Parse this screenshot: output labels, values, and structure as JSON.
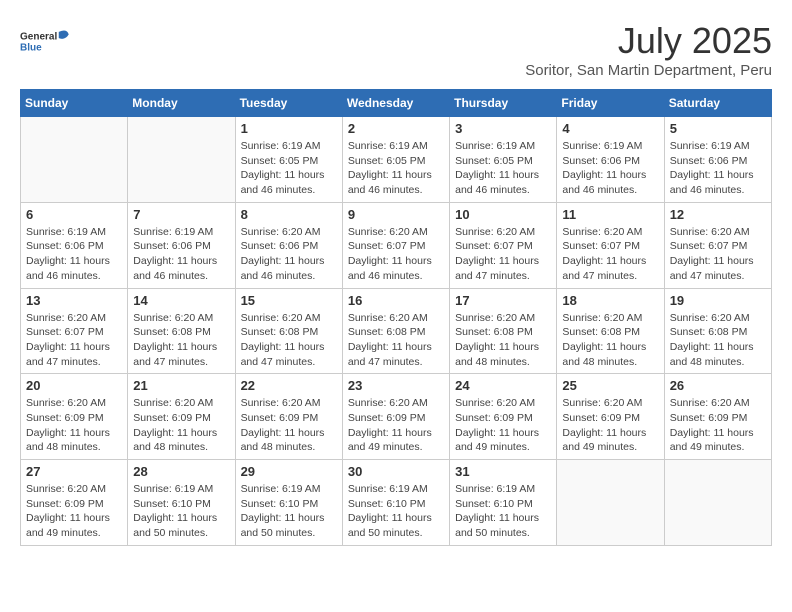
{
  "logo": {
    "general": "General",
    "blue": "Blue"
  },
  "title": {
    "month_year": "July 2025",
    "location": "Soritor, San Martin Department, Peru"
  },
  "weekdays": [
    "Sunday",
    "Monday",
    "Tuesday",
    "Wednesday",
    "Thursday",
    "Friday",
    "Saturday"
  ],
  "weeks": [
    [
      {
        "day": "",
        "info": ""
      },
      {
        "day": "",
        "info": ""
      },
      {
        "day": "1",
        "sunrise": "6:19 AM",
        "sunset": "6:05 PM",
        "daylight": "11 hours and 46 minutes."
      },
      {
        "day": "2",
        "sunrise": "6:19 AM",
        "sunset": "6:05 PM",
        "daylight": "11 hours and 46 minutes."
      },
      {
        "day": "3",
        "sunrise": "6:19 AM",
        "sunset": "6:05 PM",
        "daylight": "11 hours and 46 minutes."
      },
      {
        "day": "4",
        "sunrise": "6:19 AM",
        "sunset": "6:06 PM",
        "daylight": "11 hours and 46 minutes."
      },
      {
        "day": "5",
        "sunrise": "6:19 AM",
        "sunset": "6:06 PM",
        "daylight": "11 hours and 46 minutes."
      }
    ],
    [
      {
        "day": "6",
        "sunrise": "6:19 AM",
        "sunset": "6:06 PM",
        "daylight": "11 hours and 46 minutes."
      },
      {
        "day": "7",
        "sunrise": "6:19 AM",
        "sunset": "6:06 PM",
        "daylight": "11 hours and 46 minutes."
      },
      {
        "day": "8",
        "sunrise": "6:20 AM",
        "sunset": "6:06 PM",
        "daylight": "11 hours and 46 minutes."
      },
      {
        "day": "9",
        "sunrise": "6:20 AM",
        "sunset": "6:07 PM",
        "daylight": "11 hours and 46 minutes."
      },
      {
        "day": "10",
        "sunrise": "6:20 AM",
        "sunset": "6:07 PM",
        "daylight": "11 hours and 47 minutes."
      },
      {
        "day": "11",
        "sunrise": "6:20 AM",
        "sunset": "6:07 PM",
        "daylight": "11 hours and 47 minutes."
      },
      {
        "day": "12",
        "sunrise": "6:20 AM",
        "sunset": "6:07 PM",
        "daylight": "11 hours and 47 minutes."
      }
    ],
    [
      {
        "day": "13",
        "sunrise": "6:20 AM",
        "sunset": "6:07 PM",
        "daylight": "11 hours and 47 minutes."
      },
      {
        "day": "14",
        "sunrise": "6:20 AM",
        "sunset": "6:08 PM",
        "daylight": "11 hours and 47 minutes."
      },
      {
        "day": "15",
        "sunrise": "6:20 AM",
        "sunset": "6:08 PM",
        "daylight": "11 hours and 47 minutes."
      },
      {
        "day": "16",
        "sunrise": "6:20 AM",
        "sunset": "6:08 PM",
        "daylight": "11 hours and 47 minutes."
      },
      {
        "day": "17",
        "sunrise": "6:20 AM",
        "sunset": "6:08 PM",
        "daylight": "11 hours and 48 minutes."
      },
      {
        "day": "18",
        "sunrise": "6:20 AM",
        "sunset": "6:08 PM",
        "daylight": "11 hours and 48 minutes."
      },
      {
        "day": "19",
        "sunrise": "6:20 AM",
        "sunset": "6:08 PM",
        "daylight": "11 hours and 48 minutes."
      }
    ],
    [
      {
        "day": "20",
        "sunrise": "6:20 AM",
        "sunset": "6:09 PM",
        "daylight": "11 hours and 48 minutes."
      },
      {
        "day": "21",
        "sunrise": "6:20 AM",
        "sunset": "6:09 PM",
        "daylight": "11 hours and 48 minutes."
      },
      {
        "day": "22",
        "sunrise": "6:20 AM",
        "sunset": "6:09 PM",
        "daylight": "11 hours and 48 minutes."
      },
      {
        "day": "23",
        "sunrise": "6:20 AM",
        "sunset": "6:09 PM",
        "daylight": "11 hours and 49 minutes."
      },
      {
        "day": "24",
        "sunrise": "6:20 AM",
        "sunset": "6:09 PM",
        "daylight": "11 hours and 49 minutes."
      },
      {
        "day": "25",
        "sunrise": "6:20 AM",
        "sunset": "6:09 PM",
        "daylight": "11 hours and 49 minutes."
      },
      {
        "day": "26",
        "sunrise": "6:20 AM",
        "sunset": "6:09 PM",
        "daylight": "11 hours and 49 minutes."
      }
    ],
    [
      {
        "day": "27",
        "sunrise": "6:20 AM",
        "sunset": "6:09 PM",
        "daylight": "11 hours and 49 minutes."
      },
      {
        "day": "28",
        "sunrise": "6:19 AM",
        "sunset": "6:10 PM",
        "daylight": "11 hours and 50 minutes."
      },
      {
        "day": "29",
        "sunrise": "6:19 AM",
        "sunset": "6:10 PM",
        "daylight": "11 hours and 50 minutes."
      },
      {
        "day": "30",
        "sunrise": "6:19 AM",
        "sunset": "6:10 PM",
        "daylight": "11 hours and 50 minutes."
      },
      {
        "day": "31",
        "sunrise": "6:19 AM",
        "sunset": "6:10 PM",
        "daylight": "11 hours and 50 minutes."
      },
      {
        "day": "",
        "info": ""
      },
      {
        "day": "",
        "info": ""
      }
    ]
  ]
}
